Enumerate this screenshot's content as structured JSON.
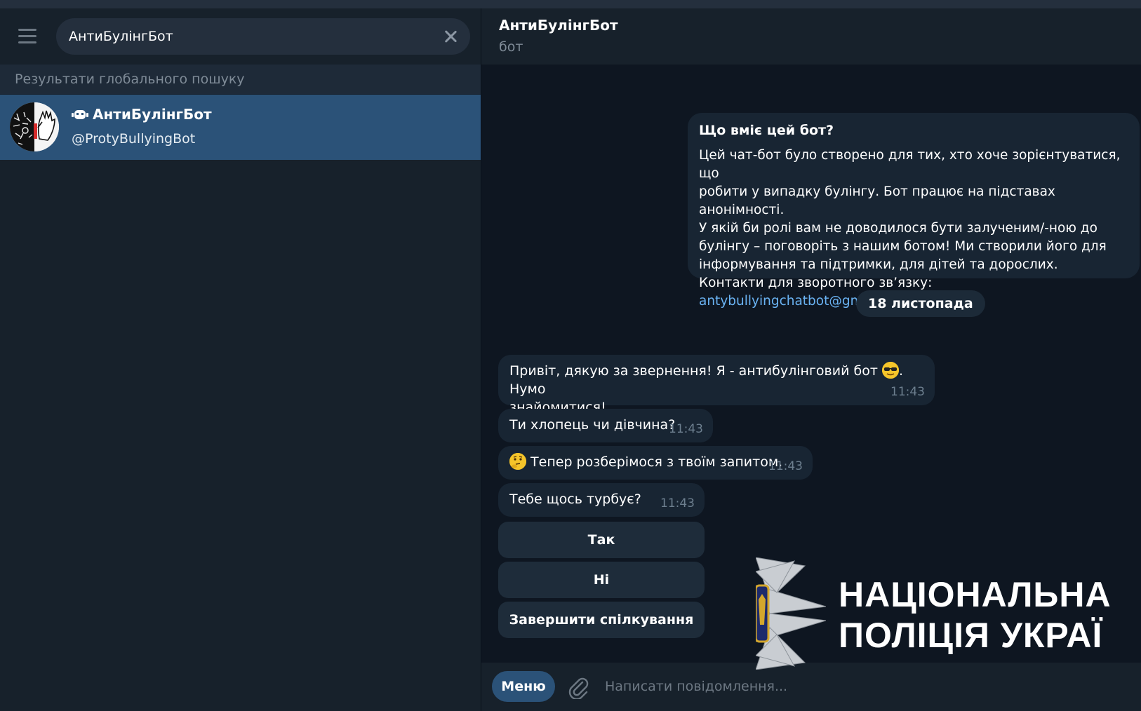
{
  "search": {
    "value": "АнтиБулінгБот",
    "section_label": "Результати глобального пошуку"
  },
  "result": {
    "name": "АнтиБулінгБот",
    "handle": "@ProtyBullyingBot"
  },
  "chat": {
    "title": "АнтиБулінгБот",
    "status": "бот"
  },
  "intro": {
    "title": "Що вміє цей бот?",
    "body": "Цей чат-бот було створено для тих, хто хоче зорієнтуватися, що\nробити у випадку булінгу. Бот працює на підставах анонімності.\nУ якій би ролі вам не доводилося бути залученим/-ною до\nбулінгу – поговоріть з нашим ботом! Ми створили його для\nінформування та підтримки, для дітей та дорослих.\nКонтакти для зворотного зв’язку: ",
    "link": "antybullyingchatbot@gmail.com"
  },
  "date_pill": "18 листопада",
  "messages": [
    {
      "text_a": "Привіт, дякую за звернення! Я - антибулінговий бот ",
      "text_b": ". Нумо\nзнайомитися!",
      "time": "11:43",
      "emoji": "sunglasses-emoji"
    },
    {
      "text": "Ти хлопець чи дівчина?",
      "time": "11:43"
    },
    {
      "text": " Тепер розберімося з твоїм запитом.",
      "time": "11:43",
      "emoji": "thinking-emoji"
    },
    {
      "text": "Тебе щось турбує?",
      "time": "11:43"
    }
  ],
  "keyboard": [
    {
      "label": "Так"
    },
    {
      "label": "Ні"
    },
    {
      "label": "Завершити спілкування"
    }
  ],
  "composer": {
    "menu_label": "Меню",
    "placeholder": "Написати повідомлення..."
  },
  "watermark": {
    "line1": "НАЦІОНАЛЬНА",
    "line2": "ПОЛІЦІЯ УКРАЇ"
  },
  "colors": {
    "background": "#0e1621",
    "panel": "#17212b",
    "selected": "#2b5278",
    "bubble": "#182533",
    "link": "#6ab3f3"
  }
}
